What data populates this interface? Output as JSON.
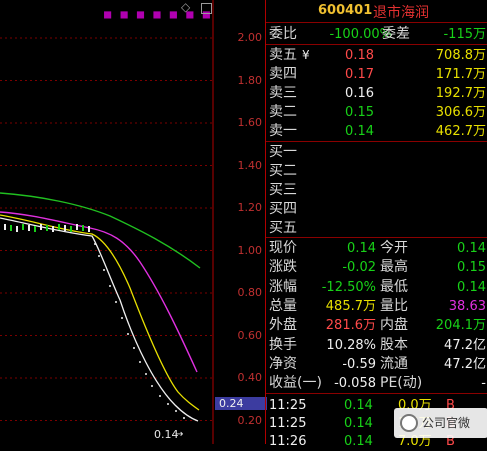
{
  "chart": {
    "price_axis": [
      "2.00",
      "1.80",
      "1.60",
      "1.40",
      "1.20",
      "1.00",
      "0.80",
      "0.60",
      "0.40",
      "0.20"
    ],
    "current_price_tag": "0.24",
    "low_marker": "0.14",
    "top_dots": "■ ■ ■ ■ ■ ■ ■",
    "colors": {
      "grid": "#7a0000",
      "ma_white": "#f0f0f0",
      "ma_yellow": "#e8e000",
      "ma_magenta": "#e030e0",
      "ma_green": "#20c020",
      "axis_text": "#c03030"
    }
  },
  "header": {
    "code": "600401",
    "name": "退市海润"
  },
  "quote": {
    "weibi_label": "委比",
    "weibi_value": "-100.00%",
    "weicha_label": "委差",
    "weicha_value": "-115万",
    "sells": [
      {
        "label": "卖五",
        "price": "0.18",
        "vol": "708.8万"
      },
      {
        "label": "卖四",
        "price": "0.17",
        "vol": "171.7万"
      },
      {
        "label": "卖三",
        "price": "0.16",
        "vol": "192.7万"
      },
      {
        "label": "卖二",
        "price": "0.15",
        "vol": "306.6万"
      },
      {
        "label": "卖一",
        "price": "0.14",
        "vol": "462.7万"
      }
    ],
    "buys": [
      {
        "label": "买一"
      },
      {
        "label": "买二"
      },
      {
        "label": "买三"
      },
      {
        "label": "买四"
      },
      {
        "label": "买五"
      }
    ],
    "sell5_mark": "¥",
    "stats": [
      {
        "l1": "现价",
        "v1": "0.14",
        "l2": "今开",
        "v2": "0.14"
      },
      {
        "l1": "涨跌",
        "v1": "-0.02",
        "l2": "最高",
        "v2": "0.15"
      },
      {
        "l1": "涨幅",
        "v1": "-12.50%",
        "l2": "最低",
        "v2": "0.14"
      },
      {
        "l1": "总量",
        "v1": "485.7万",
        "l2": "量比",
        "v2": "38.63"
      },
      {
        "l1": "外盘",
        "v1": "281.6万",
        "l2": "内盘",
        "v2": "204.1万"
      },
      {
        "l1": "换手",
        "v1": "10.28%",
        "l2": "股本",
        "v2": "47.2亿"
      },
      {
        "l1": "净资",
        "v1": "-0.59",
        "l2": "流通",
        "v2": "47.2亿"
      },
      {
        "l1": "收益(一)",
        "v1": "-0.058",
        "l2": "PE(动)",
        "v2": "-"
      }
    ],
    "ticks": [
      {
        "time": "11:25",
        "price": "0.14",
        "vol": "0.0万",
        "flag": "B"
      },
      {
        "time": "11:25",
        "price": "0.14",
        "vol": "1.5万",
        "flag": "B"
      },
      {
        "time": "11:26",
        "price": "0.14",
        "vol": "7.0万",
        "flag": "B"
      }
    ],
    "watermark": "公司官微"
  }
}
